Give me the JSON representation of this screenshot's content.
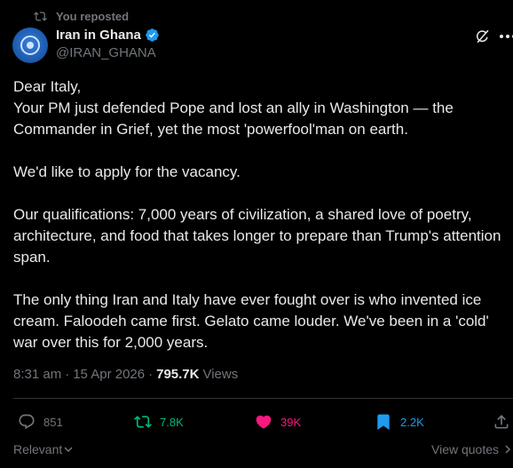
{
  "repost_banner": {
    "text": "You reposted"
  },
  "author": {
    "name": "Iran in Ghana",
    "handle": "@IRAN_GHANA"
  },
  "tweet": {
    "paragraphs": [
      "Dear Italy,",
      "Your PM just defended Pope and lost an ally in Washington — the Commander in Grief, yet the most 'powerfool'man on earth.",
      "We'd like to apply for the vacancy.",
      "Our qualifications: 7,000 years of civilization, a shared love of poetry, architecture, and food that takes longer to prepare than Trump's attention span.",
      "The only thing Iran and Italy have ever fought over is who invented ice cream. Faloodeh came first. Gelato came louder. We've been in a 'cold' war over this for 2,000 years."
    ]
  },
  "meta": {
    "time": "8:31 am",
    "separator": "·",
    "date": "15 Apr 2026",
    "separator2": "·",
    "views_count": "795.7K",
    "views_label": "Views"
  },
  "actions": {
    "replies": "851",
    "reposts": "7.8K",
    "likes": "39K",
    "bookmarks": "2.2K"
  },
  "footer": {
    "sort_label": "Relevant",
    "view_quotes_label": "View quotes"
  },
  "colors": {
    "background": "#000000",
    "text": "#e7e9ea",
    "muted": "#71767b",
    "repost_green": "#00ba7c",
    "like_pink": "#f91880",
    "bookmark_blue": "#1d9bf0",
    "verified_blue": "#1d9bf0"
  },
  "icons": {
    "repost_banner": "repost-icon",
    "verified": "verified-badge-icon",
    "grok": "grok-icon",
    "more": "more-icon",
    "reply": "reply-icon",
    "repost": "repost-icon",
    "like": "heart-icon",
    "bookmark": "bookmark-icon",
    "share": "share-icon"
  }
}
